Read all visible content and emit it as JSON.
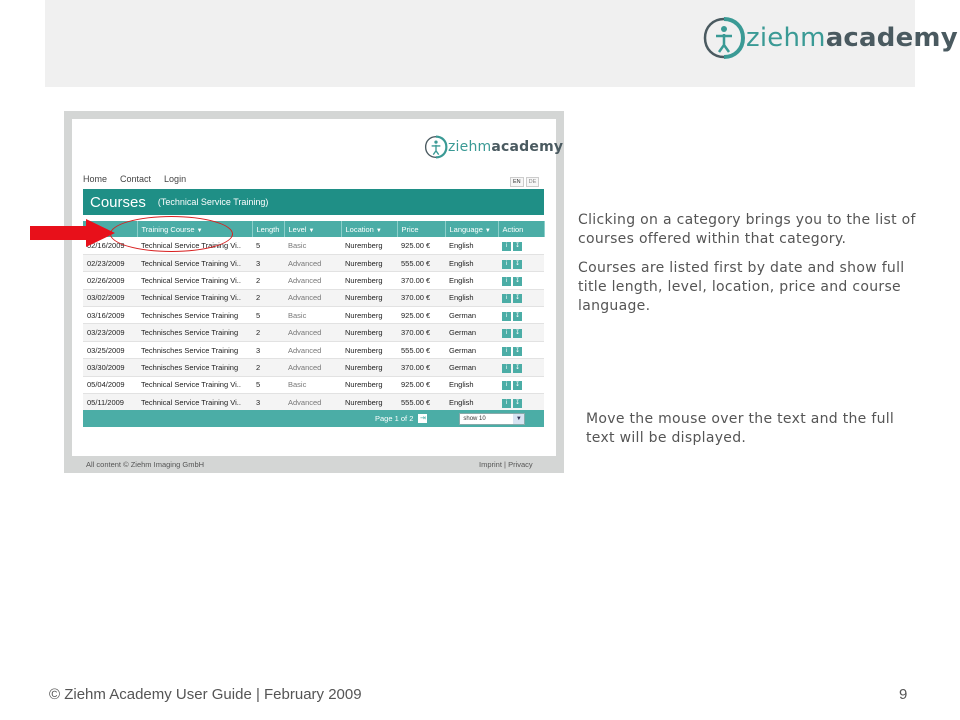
{
  "slide": {
    "brand": {
      "part1": "ziehm",
      "part2": "academy"
    },
    "notes": [
      "Clicking on a category brings you to the list of courses offered within that category.",
      "Courses are listed first by date and show full title length, level, location, price and course language.",
      "Move the mouse over the text and the full text will be displayed."
    ],
    "footer": "© Ziehm Academy User Guide | February 2009",
    "page_number": "9",
    "colors": {
      "accent_red": "#d81f1f",
      "brand_teal": "#3a9a95"
    }
  },
  "screenshot": {
    "brand": {
      "part1": "ziehm",
      "part2": "academy"
    },
    "nav": {
      "home": "Home",
      "contact": "Contact",
      "login": "Login"
    },
    "lang": {
      "en": "EN",
      "de": "DE"
    },
    "courses_title": "Courses",
    "courses_subtitle": "(Technical Service Training)",
    "columns": [
      "Training Course",
      "Length",
      "Level",
      "Location",
      "Price",
      "Language",
      "Action"
    ],
    "rows": [
      {
        "date": "02/16/2009",
        "course": "Technical Service Training Vi..",
        "length": "5",
        "level": "Basic",
        "location": "Nuremberg",
        "price": "925.00 €",
        "language": "English"
      },
      {
        "date": "02/23/2009",
        "course": "Technical Service Training Vi..",
        "length": "3",
        "level": "Advanced",
        "location": "Nuremberg",
        "price": "555.00 €",
        "language": "English"
      },
      {
        "date": "02/26/2009",
        "course": "Technical Service Training Vi..",
        "length": "2",
        "level": "Advanced",
        "location": "Nuremberg",
        "price": "370.00 €",
        "language": "English"
      },
      {
        "date": "03/02/2009",
        "course": "Technical Service Training Vi..",
        "length": "2",
        "level": "Advanced",
        "location": "Nuremberg",
        "price": "370.00 €",
        "language": "English"
      },
      {
        "date": "03/16/2009",
        "course": "Technisches Service Training",
        "length": "5",
        "level": "Basic",
        "location": "Nuremberg",
        "price": "925.00 €",
        "language": "German"
      },
      {
        "date": "03/23/2009",
        "course": "Technisches Service Training",
        "length": "2",
        "level": "Advanced",
        "location": "Nuremberg",
        "price": "370.00 €",
        "language": "German"
      },
      {
        "date": "03/25/2009",
        "course": "Technisches Service Training",
        "length": "3",
        "level": "Advanced",
        "location": "Nuremberg",
        "price": "555.00 €",
        "language": "German"
      },
      {
        "date": "03/30/2009",
        "course": "Technisches Service Training",
        "length": "2",
        "level": "Advanced",
        "location": "Nuremberg",
        "price": "370.00 €",
        "language": "German"
      },
      {
        "date": "05/04/2009",
        "course": "Technical Service Training Vi..",
        "length": "5",
        "level": "Basic",
        "location": "Nuremberg",
        "price": "925.00 €",
        "language": "English"
      },
      {
        "date": "05/11/2009",
        "course": "Technical Service Training Vi..",
        "length": "3",
        "level": "Advanced",
        "location": "Nuremberg",
        "price": "555.00 €",
        "language": "English"
      }
    ],
    "action_icons": [
      "info-icon",
      "enroll-icon"
    ],
    "pager": {
      "label": "Page 1 of 2",
      "next": "⇥",
      "show_select": "show 10"
    },
    "footer": {
      "copyright": "All content © Ziehm Imaging GmbH",
      "imprint": "Imprint",
      "sep": "|",
      "privacy": "Privacy"
    }
  }
}
